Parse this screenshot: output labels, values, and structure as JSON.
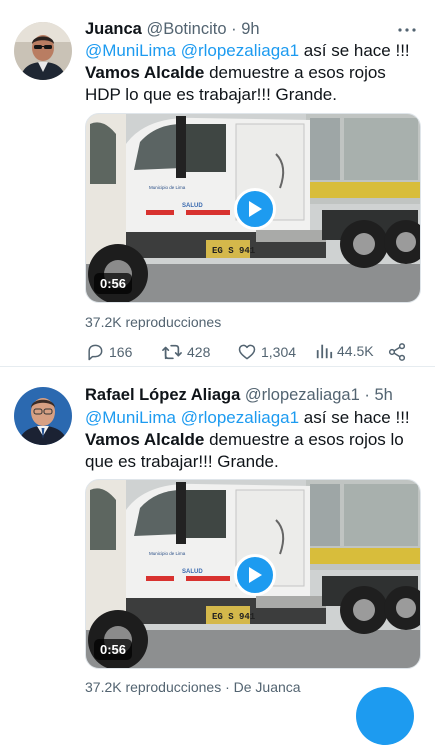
{
  "tweets": [
    {
      "author_name": "Juanca",
      "handle": "@Botincito",
      "separator": "·",
      "time": "9h",
      "text_mention1": "@MuniLima",
      "text_mention2": "@rlopezaliaga1",
      "text_part1": " así se hace !!!",
      "text_bold": "Vamos Alcalde",
      "text_part2": " demuestre a esos rojos HDP lo que es trabajar!!! Grande.",
      "video_duration": "0:56",
      "views": "37.2K reproducciones",
      "replies": "166",
      "retweets": "428",
      "likes": "1,304",
      "analytics": "44.5K"
    },
    {
      "author_name": "Rafael López Aliaga",
      "handle": "@rlopezaliaga1",
      "separator": "·",
      "time": "5h",
      "text_mention1": "@MuniLima",
      "text_mention2": "@rlopezaliaga1",
      "text_part1": " así se hace !!!",
      "text_bold": "Vamos Alcalde",
      "text_part2": " demuestre a esos rojos lo que es trabajar!!! Grande.",
      "video_duration": "0:56",
      "views": "37.2K reproducciones",
      "views_from": "· De Juanca"
    }
  ],
  "truck": {
    "door_text": "Municipio de Lima",
    "salud": "SALUD",
    "plate": "EG S 941"
  },
  "icons": {
    "more": "more-dots-icon",
    "reply": "reply-icon",
    "retweet": "retweet-icon",
    "like": "heart-icon",
    "analytics": "analytics-icon",
    "share": "share-icon",
    "play": "play-icon"
  },
  "colors": {
    "accent": "#1d9bf0",
    "text": "#0f1419",
    "secondary": "#536471"
  }
}
